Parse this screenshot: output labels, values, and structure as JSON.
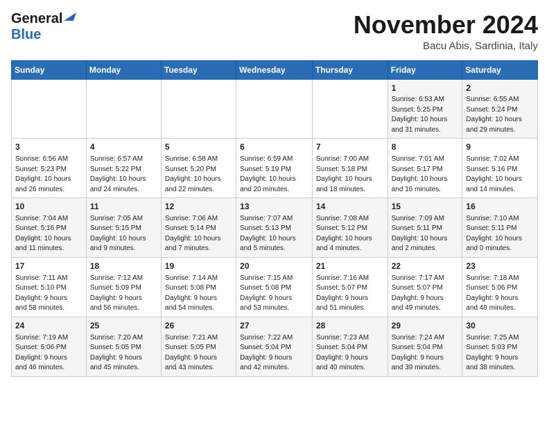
{
  "header": {
    "logo_general": "General",
    "logo_blue": "Blue",
    "month": "November 2024",
    "location": "Bacu Abis, Sardinia, Italy"
  },
  "days_of_week": [
    "Sunday",
    "Monday",
    "Tuesday",
    "Wednesday",
    "Thursday",
    "Friday",
    "Saturday"
  ],
  "weeks": [
    [
      {
        "day": "",
        "info": ""
      },
      {
        "day": "",
        "info": ""
      },
      {
        "day": "",
        "info": ""
      },
      {
        "day": "",
        "info": ""
      },
      {
        "day": "",
        "info": ""
      },
      {
        "day": "1",
        "info": "Sunrise: 6:53 AM\nSunset: 5:25 PM\nDaylight: 10 hours\nand 31 minutes."
      },
      {
        "day": "2",
        "info": "Sunrise: 6:55 AM\nSunset: 5:24 PM\nDaylight: 10 hours\nand 29 minutes."
      }
    ],
    [
      {
        "day": "3",
        "info": "Sunrise: 6:56 AM\nSunset: 5:23 PM\nDaylight: 10 hours\nand 26 minutes."
      },
      {
        "day": "4",
        "info": "Sunrise: 6:57 AM\nSunset: 5:22 PM\nDaylight: 10 hours\nand 24 minutes."
      },
      {
        "day": "5",
        "info": "Sunrise: 6:58 AM\nSunset: 5:20 PM\nDaylight: 10 hours\nand 22 minutes."
      },
      {
        "day": "6",
        "info": "Sunrise: 6:59 AM\nSunset: 5:19 PM\nDaylight: 10 hours\nand 20 minutes."
      },
      {
        "day": "7",
        "info": "Sunrise: 7:00 AM\nSunset: 5:18 PM\nDaylight: 10 hours\nand 18 minutes."
      },
      {
        "day": "8",
        "info": "Sunrise: 7:01 AM\nSunset: 5:17 PM\nDaylight: 10 hours\nand 16 minutes."
      },
      {
        "day": "9",
        "info": "Sunrise: 7:02 AM\nSunset: 5:16 PM\nDaylight: 10 hours\nand 14 minutes."
      }
    ],
    [
      {
        "day": "10",
        "info": "Sunrise: 7:04 AM\nSunset: 5:16 PM\nDaylight: 10 hours\nand 11 minutes."
      },
      {
        "day": "11",
        "info": "Sunrise: 7:05 AM\nSunset: 5:15 PM\nDaylight: 10 hours\nand 9 minutes."
      },
      {
        "day": "12",
        "info": "Sunrise: 7:06 AM\nSunset: 5:14 PM\nDaylight: 10 hours\nand 7 minutes."
      },
      {
        "day": "13",
        "info": "Sunrise: 7:07 AM\nSunset: 5:13 PM\nDaylight: 10 hours\nand 5 minutes."
      },
      {
        "day": "14",
        "info": "Sunrise: 7:08 AM\nSunset: 5:12 PM\nDaylight: 10 hours\nand 4 minutes."
      },
      {
        "day": "15",
        "info": "Sunrise: 7:09 AM\nSunset: 5:11 PM\nDaylight: 10 hours\nand 2 minutes."
      },
      {
        "day": "16",
        "info": "Sunrise: 7:10 AM\nSunset: 5:11 PM\nDaylight: 10 hours\nand 0 minutes."
      }
    ],
    [
      {
        "day": "17",
        "info": "Sunrise: 7:11 AM\nSunset: 5:10 PM\nDaylight: 9 hours\nand 58 minutes."
      },
      {
        "day": "18",
        "info": "Sunrise: 7:12 AM\nSunset: 5:09 PM\nDaylight: 9 hours\nand 56 minutes."
      },
      {
        "day": "19",
        "info": "Sunrise: 7:14 AM\nSunset: 5:08 PM\nDaylight: 9 hours\nand 54 minutes."
      },
      {
        "day": "20",
        "info": "Sunrise: 7:15 AM\nSunset: 5:08 PM\nDaylight: 9 hours\nand 53 minutes."
      },
      {
        "day": "21",
        "info": "Sunrise: 7:16 AM\nSunset: 5:07 PM\nDaylight: 9 hours\nand 51 minutes."
      },
      {
        "day": "22",
        "info": "Sunrise: 7:17 AM\nSunset: 5:07 PM\nDaylight: 9 hours\nand 49 minutes."
      },
      {
        "day": "23",
        "info": "Sunrise: 7:18 AM\nSunset: 5:06 PM\nDaylight: 9 hours\nand 48 minutes."
      }
    ],
    [
      {
        "day": "24",
        "info": "Sunrise: 7:19 AM\nSunset: 5:06 PM\nDaylight: 9 hours\nand 46 minutes."
      },
      {
        "day": "25",
        "info": "Sunrise: 7:20 AM\nSunset: 5:05 PM\nDaylight: 9 hours\nand 45 minutes."
      },
      {
        "day": "26",
        "info": "Sunrise: 7:21 AM\nSunset: 5:05 PM\nDaylight: 9 hours\nand 43 minutes."
      },
      {
        "day": "27",
        "info": "Sunrise: 7:22 AM\nSunset: 5:04 PM\nDaylight: 9 hours\nand 42 minutes."
      },
      {
        "day": "28",
        "info": "Sunrise: 7:23 AM\nSunset: 5:04 PM\nDaylight: 9 hours\nand 40 minutes."
      },
      {
        "day": "29",
        "info": "Sunrise: 7:24 AM\nSunset: 5:04 PM\nDaylight: 9 hours\nand 39 minutes."
      },
      {
        "day": "30",
        "info": "Sunrise: 7:25 AM\nSunset: 5:03 PM\nDaylight: 9 hours\nand 38 minutes."
      }
    ]
  ]
}
